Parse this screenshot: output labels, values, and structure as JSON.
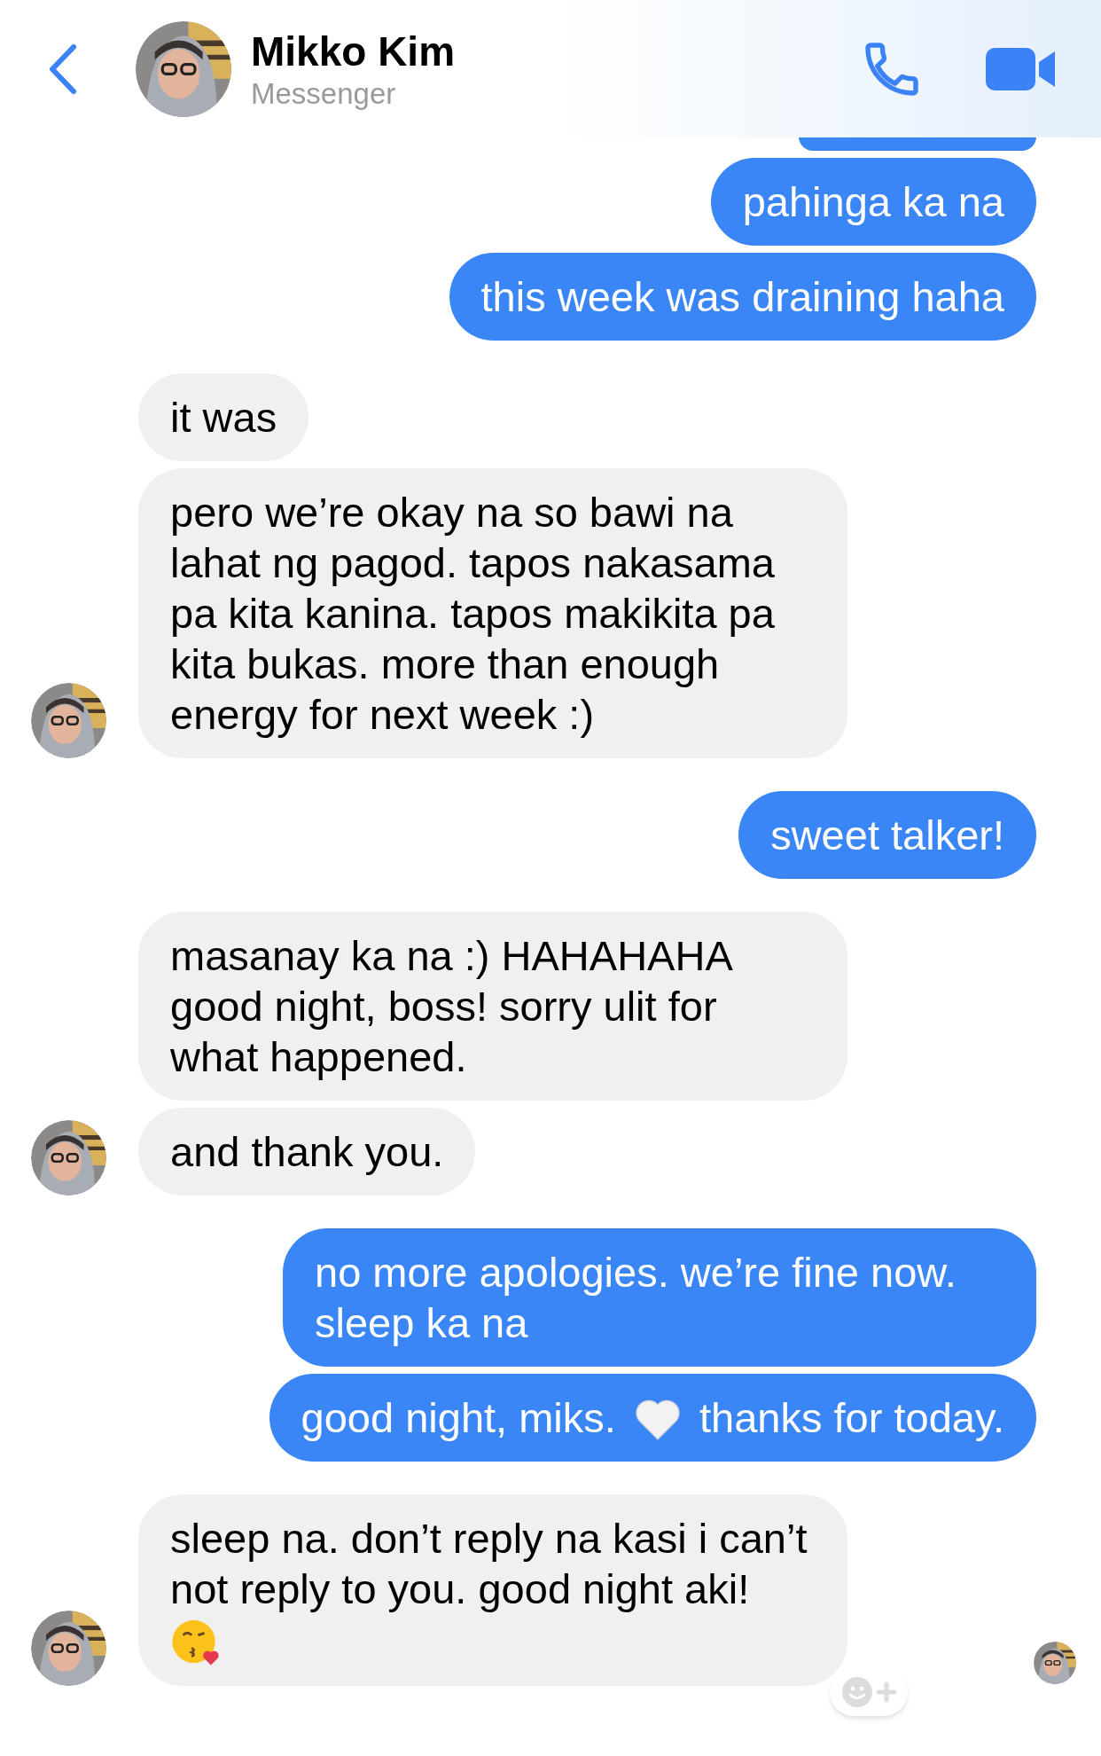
{
  "header": {
    "name": "Mikko Kim",
    "subtitle": "Messenger"
  },
  "messages": [
    {
      "kind": "sent",
      "segments": [
        {
          "kind": "text",
          "text": "pahinga ka na"
        }
      ]
    },
    {
      "kind": "sent",
      "segments": [
        {
          "kind": "text",
          "text": "this week was draining haha"
        }
      ],
      "group_end": true
    },
    {
      "kind": "received",
      "segments": [
        {
          "kind": "text",
          "text": "it was"
        }
      ]
    },
    {
      "kind": "received",
      "segments": [
        {
          "kind": "text",
          "text": "pero we’re okay na so bawi na lahat ng pagod. tapos nakasama pa kita kanina. tapos makikita pa kita bukas. more than enough energy for next week :)"
        }
      ],
      "avatar": true,
      "group_end": true
    },
    {
      "kind": "sent",
      "segments": [
        {
          "kind": "text",
          "text": "sweet talker!"
        }
      ],
      "group_end": true
    },
    {
      "kind": "received",
      "segments": [
        {
          "kind": "text",
          "text": "masanay ka na :) HAHAHAHA good night, boss! sorry ulit for what happened."
        }
      ]
    },
    {
      "kind": "received",
      "segments": [
        {
          "kind": "text",
          "text": "and thank you."
        }
      ],
      "avatar": true,
      "group_end": true
    },
    {
      "kind": "sent",
      "segments": [
        {
          "kind": "text",
          "text": "no more apologies. we’re fine now. sleep ka na"
        }
      ]
    },
    {
      "kind": "sent",
      "segments": [
        {
          "kind": "text",
          "text": "good night, miks."
        },
        {
          "kind": "heart"
        },
        {
          "kind": "text",
          "text": "thanks for today."
        }
      ],
      "group_end": true
    },
    {
      "kind": "received",
      "segments": [
        {
          "kind": "text",
          "text": "sleep na. don’t reply na kasi i can’t not reply to you. good night aki!"
        },
        {
          "kind": "kiss"
        }
      ],
      "avatar": true,
      "react_button": true,
      "seen": true,
      "group_end": true
    }
  ]
}
